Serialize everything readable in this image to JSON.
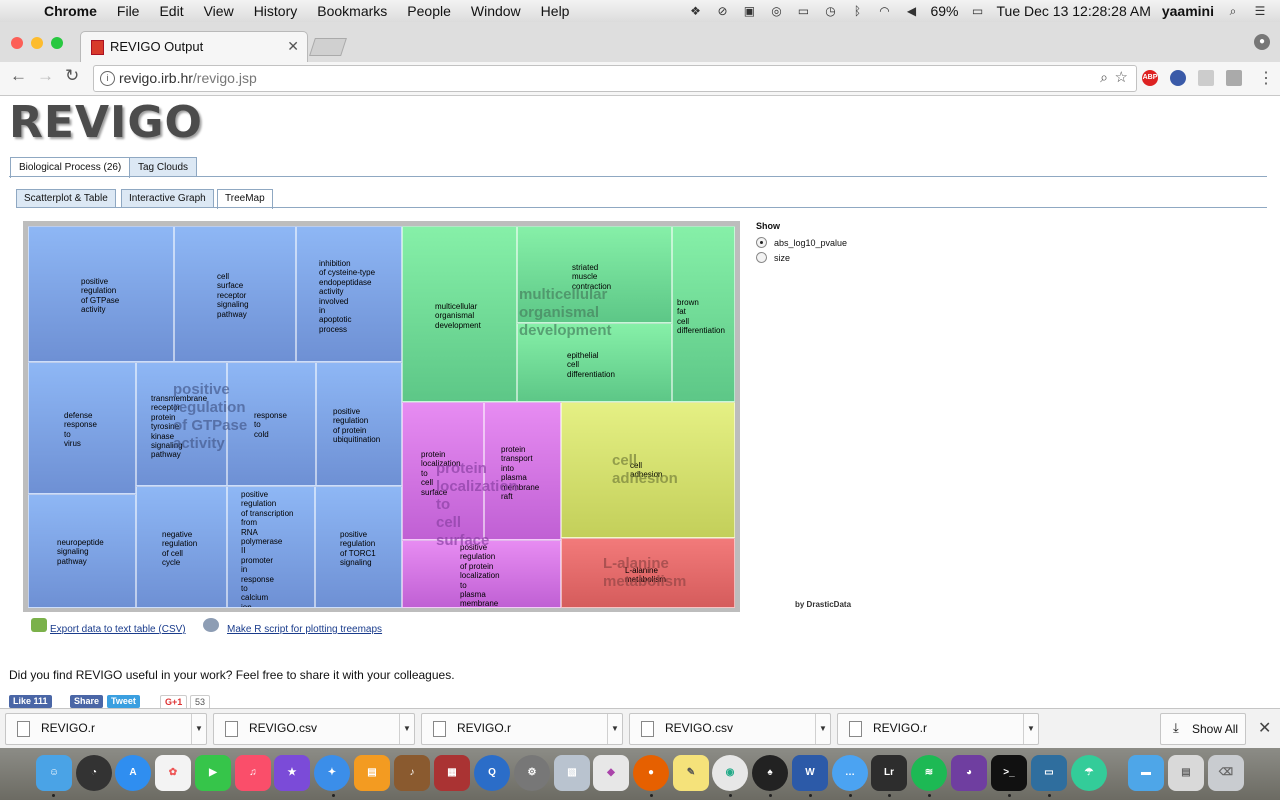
{
  "menubar": {
    "app": "Chrome",
    "items": [
      "File",
      "Edit",
      "View",
      "History",
      "Bookmarks",
      "People",
      "Window",
      "Help"
    ],
    "battery": "69%",
    "clock": "Tue Dec 13  12:28:28 AM",
    "user": "yaamini"
  },
  "browser": {
    "tab_title": "REVIGO Output",
    "url_host": "revigo.irb.hr",
    "url_path": "/revigo.jsp",
    "ext_abp": "ABP"
  },
  "page": {
    "logo": "REVIGO",
    "tabs_main": [
      "Biological Process (26)",
      "Tag Clouds"
    ],
    "tabs_sub": [
      "Scatterplot & Table",
      "Interactive Graph",
      "TreeMap"
    ],
    "show": {
      "title": "Show",
      "options": [
        "abs_log10_pvalue",
        "size"
      ],
      "selected": "abs_log10_pvalue"
    },
    "byline": "by DrasticData",
    "export_csv": "Export data to text table (CSV)",
    "r_script": "Make R script for plotting treemaps",
    "question": "Did you find REVIGO useful in your work? Feel free to share it with your colleagues.",
    "share": {
      "like": "Like 111",
      "share": "Share",
      "tweet": "Tweet",
      "gplus": "G+1",
      "gcount": "53"
    }
  },
  "treemap": {
    "groups": [
      {
        "name": "positive\nregulation\nof GTPase\nactivity"
      },
      {
        "name": "multicellular\norganismal\ndevelopment"
      },
      {
        "name": "protein\nlocalization\nto\ncell\nsurface"
      },
      {
        "name": "cell\nadhesion"
      },
      {
        "name": "L-alanine\nmetabolism"
      }
    ],
    "cells": [
      {
        "label": "positive\nregulation\nof GTPase\nactivity"
      },
      {
        "label": "cell\nsurface\nreceptor\nsignaling\npathway"
      },
      {
        "label": "inhibition\nof cysteine-type\nendopeptidase\nactivity\ninvolved\nin\napoptotic\nprocess"
      },
      {
        "label": "defense\nresponse\nto\nvirus"
      },
      {
        "label": "transmembrane\nreceptor\nprotein\ntyrosine\nkinase\nsignaling\npathway"
      },
      {
        "label": "response\nto\ncold"
      },
      {
        "label": "positive\nregulation\nof protein\nubiquitination"
      },
      {
        "label": "neuropeptide\nsignaling\npathway"
      },
      {
        "label": "negative\nregulation\nof cell\ncycle"
      },
      {
        "label": "positive\nregulation\nof transcription\nfrom\nRNA\npolymerase\nII\npromoter\nin\nresponse\nto\ncalcium\nion"
      },
      {
        "label": "positive\nregulation\nof TORC1\nsignaling"
      },
      {
        "label": "multicellular\norganismal\ndevelopment"
      },
      {
        "label": "striated\nmuscle\ncontraction"
      },
      {
        "label": "epithelial\ncell\ndifferentiation"
      },
      {
        "label": "brown\nfat\ncell\ndifferentiation"
      },
      {
        "label": "protein\nlocalization\nto\ncell\nsurface"
      },
      {
        "label": "protein\ntransport\ninto\nplasma\nmembrane\nraft"
      },
      {
        "label": "positive\nregulation\nof protein\nlocalization\nto\nplasma\nmembrane"
      },
      {
        "label": "cell\nadhesion"
      },
      {
        "label": "L-alanine\nmetabolism"
      }
    ]
  },
  "downloads": {
    "files": [
      "REVIGO.r",
      "REVIGO.csv",
      "REVIGO.r",
      "REVIGO.csv",
      "REVIGO.r"
    ],
    "show_all": "Show All"
  },
  "colors": {
    "treemap_blue": "#7fa4e6",
    "treemap_green": "#72dd98",
    "treemap_purple": "#d276e4",
    "treemap_yellow": "#d6e070",
    "treemap_red": "#e46a6a",
    "link": "#1a3c8c"
  }
}
